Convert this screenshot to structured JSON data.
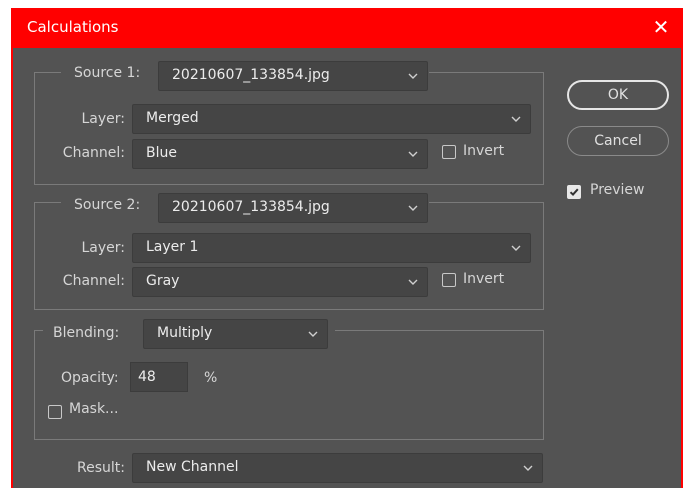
{
  "window": {
    "title": "Calculations",
    "close_glyph": "✕"
  },
  "source1": {
    "label": "Source 1:",
    "file": "20210607_133854.jpg",
    "layer_label": "Layer:",
    "layer": "Merged",
    "channel_label": "Channel:",
    "channel": "Blue",
    "invert_label": "Invert",
    "invert_checked": false
  },
  "source2": {
    "label": "Source 2:",
    "file": "20210607_133854.jpg",
    "layer_label": "Layer:",
    "layer": "Layer 1",
    "channel_label": "Channel:",
    "channel": "Gray",
    "invert_label": "Invert",
    "invert_checked": false
  },
  "blending": {
    "label": "Blending:",
    "mode": "Multiply",
    "opacity_label": "Opacity:",
    "opacity_value": "48",
    "opacity_unit": "%",
    "mask_label": "Mask...",
    "mask_checked": false
  },
  "result": {
    "label": "Result:",
    "value": "New Channel"
  },
  "buttons": {
    "ok": "OK",
    "cancel": "Cancel"
  },
  "preview": {
    "label": "Preview",
    "checked": true
  },
  "colors": {
    "title_bar": "#ff0000",
    "dialog_bg": "#535353",
    "field_bg": "#454545"
  },
  "icons": {
    "dropdown": "chevron-down-icon",
    "checkmark": "checkmark-icon",
    "close": "close-icon"
  }
}
